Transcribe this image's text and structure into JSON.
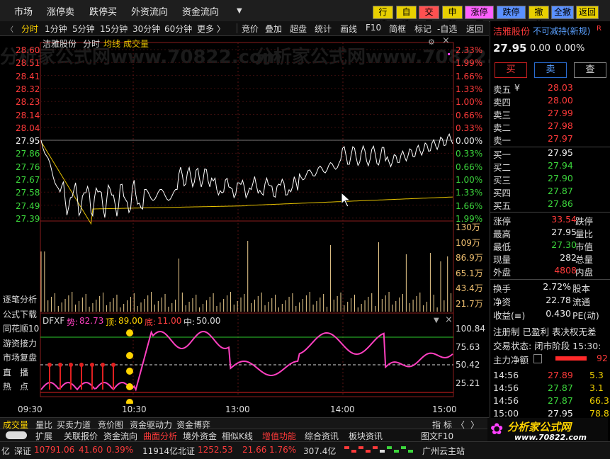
{
  "top_menu": [
    "市场",
    "涨停卖",
    "跌停买",
    "外资流向",
    "资金流向"
  ],
  "quick_buttons": [
    {
      "label": "行情",
      "color": "#e8d000"
    },
    {
      "label": "自选",
      "color": "#e8d000"
    },
    {
      "label": "交易",
      "color": "#ff5050"
    },
    {
      "label": "申新",
      "color": "#e8d000"
    },
    {
      "label": "涨停买",
      "color": "#ff60ff"
    },
    {
      "label": "跌停卖",
      "color": "#5a90ff"
    },
    {
      "label": "撤单",
      "color": "#e8d000"
    },
    {
      "label": "全撤",
      "color": "#5a90ff"
    },
    {
      "label": "返回",
      "color": "#e8d000"
    }
  ],
  "tabs": [
    "分时",
    "1分钟",
    "5分钟",
    "15分钟",
    "30分钟",
    "60分钟",
    "更多 〉"
  ],
  "tools": [
    "竞价",
    "叠加",
    "超盘",
    "统计",
    "画线",
    "F10",
    "简框",
    "标记",
    "-自选",
    "返回"
  ],
  "stock": {
    "name": "洁雅股份",
    "status": "不可减持(新规)",
    "price": "27.95",
    "change": "0.00",
    "pct": "0.00%"
  },
  "chart_header": {
    "name": "洁雅股份",
    "mode": "分时",
    "avg": "均线",
    "vol": "成交量"
  },
  "price_ticks": [
    "28.60",
    "28.51",
    "28.41",
    "28.32",
    "28.23",
    "28.14",
    "28.04",
    "27.95",
    "27.86",
    "27.76",
    "27.67",
    "27.58",
    "27.49",
    "27.39"
  ],
  "pct_ticks": [
    "2.33%",
    "1.99%",
    "1.66%",
    "1.33%",
    "1.00%",
    "0.66%",
    "0.33%",
    "0.00%",
    "0.33%",
    "0.66%",
    "1.00%",
    "1.33%",
    "1.66%",
    "1.99%"
  ],
  "vol_ticks": [
    "130万",
    "109万",
    "86.9万",
    "65.1万",
    "43.4万",
    "21.7万"
  ],
  "left_labels": [
    "逐笔分析",
    "公式下载",
    "同花顺10",
    "游资接力",
    "市场复盘",
    "直　播",
    "热　点"
  ],
  "indicator": {
    "name": "DFXF",
    "a_label": "势:",
    "a_val": "82.73",
    "b_label": "顶:",
    "b_val": "89.00",
    "c_label": "底:",
    "c_val": "11.00",
    "d_label": "中:",
    "d_val": "50.00"
  },
  "ind_ticks": [
    "100.84",
    "75.63",
    "50.42",
    "25.21"
  ],
  "time_ticks": [
    "09:30",
    "10:30",
    "13:00",
    "14:00",
    "15:00"
  ],
  "bottom_tabs": [
    "成交量",
    "量比",
    "买卖力道",
    "竞价图",
    "资金驱动力",
    "资金博弈"
  ],
  "bottom_right": [
    "指",
    "标"
  ],
  "bottom_tabs2": [
    "扩展",
    "关联报价",
    "资金流向",
    "曲面分析",
    "境外资金",
    "相似K线",
    "增值功能",
    "综合资讯",
    "板块资讯"
  ],
  "f10_label": "图文F10",
  "sell_quotes": [
    {
      "label": "卖五",
      "price": "28.03"
    },
    {
      "label": "卖四",
      "price": "28.00"
    },
    {
      "label": "卖三",
      "price": "27.99"
    },
    {
      "label": "卖二",
      "price": "27.98"
    },
    {
      "label": "卖一",
      "price": "27.97"
    }
  ],
  "sell5_mark": "¥",
  "buy_quotes": [
    {
      "label": "买一",
      "price": "27.95"
    },
    {
      "label": "买二",
      "price": "27.94"
    },
    {
      "label": "买三",
      "price": "27.90"
    },
    {
      "label": "买四",
      "price": "27.87"
    },
    {
      "label": "买五",
      "price": "27.86"
    }
  ],
  "trade_buttons": [
    "买",
    "卖",
    "查"
  ],
  "stats": [
    {
      "l": "涨停",
      "v": "33.54",
      "vc": "#ff3a3a",
      "l2": "跌停"
    },
    {
      "l": "最高",
      "v": "27.95",
      "vc": "#eee",
      "l2": "量比"
    },
    {
      "l": "最低",
      "v": "27.30",
      "vc": "#3cd63c",
      "l2": "市值"
    },
    {
      "l": "现量",
      "v": "282",
      "vc": "#eee",
      "l2": "总量"
    },
    {
      "l": "外盘",
      "v": "4808",
      "vc": "#ff3a3a",
      "l2": "内盘"
    }
  ],
  "stats2": [
    {
      "l": "换手",
      "v": "2.72%",
      "l2": "股本"
    },
    {
      "l": "净资",
      "v": "22.78",
      "l2": "流通"
    },
    {
      "l": "收益(≡)",
      "v": "0.430",
      "l2": "PE(动)"
    }
  ],
  "reg_line": "注册制  已盈利  表决权无差",
  "trade_status": "交易状态: 闭市阶段 15:30:",
  "main_flow": {
    "label": "主力净额",
    "value": "92"
  },
  "ticks": [
    {
      "t": "14:56",
      "p": "27.89",
      "c": "#ff3a3a",
      "v": "5.3"
    },
    {
      "t": "14:56",
      "p": "27.87",
      "c": "#3cd63c",
      "v": "3.1"
    },
    {
      "t": "14:56",
      "p": "27.87",
      "c": "#3cd63c",
      "v": "66.3"
    },
    {
      "t": "15:00",
      "p": "27.95",
      "c": "#eee",
      "v": "78.8"
    }
  ],
  "status_bar": {
    "item0": "亿",
    "sz_label": "深证",
    "sz_val": "10791.06",
    "sz_chg": "41.60",
    "sz_pct": "0.39%",
    "sz_amt": "11914亿",
    "bz_label": "北证",
    "bz_val": "1252.53",
    "bz_chg": "21.66",
    "bz_pct": "1.76%",
    "bz_amt": "307.4亿",
    "news": "广州云主站"
  },
  "logo": {
    "main": "分析家公式网",
    "url": "www.70822.com"
  },
  "watermark": "分析家公式网www.70822.com",
  "colors": {
    "up": "#ff3a3a",
    "down": "#3cd63c",
    "price_line": "#ffffff",
    "avg_line": "#e6c200",
    "vol_bar": "#f0d090",
    "ind_line": "#ff40c0"
  }
}
